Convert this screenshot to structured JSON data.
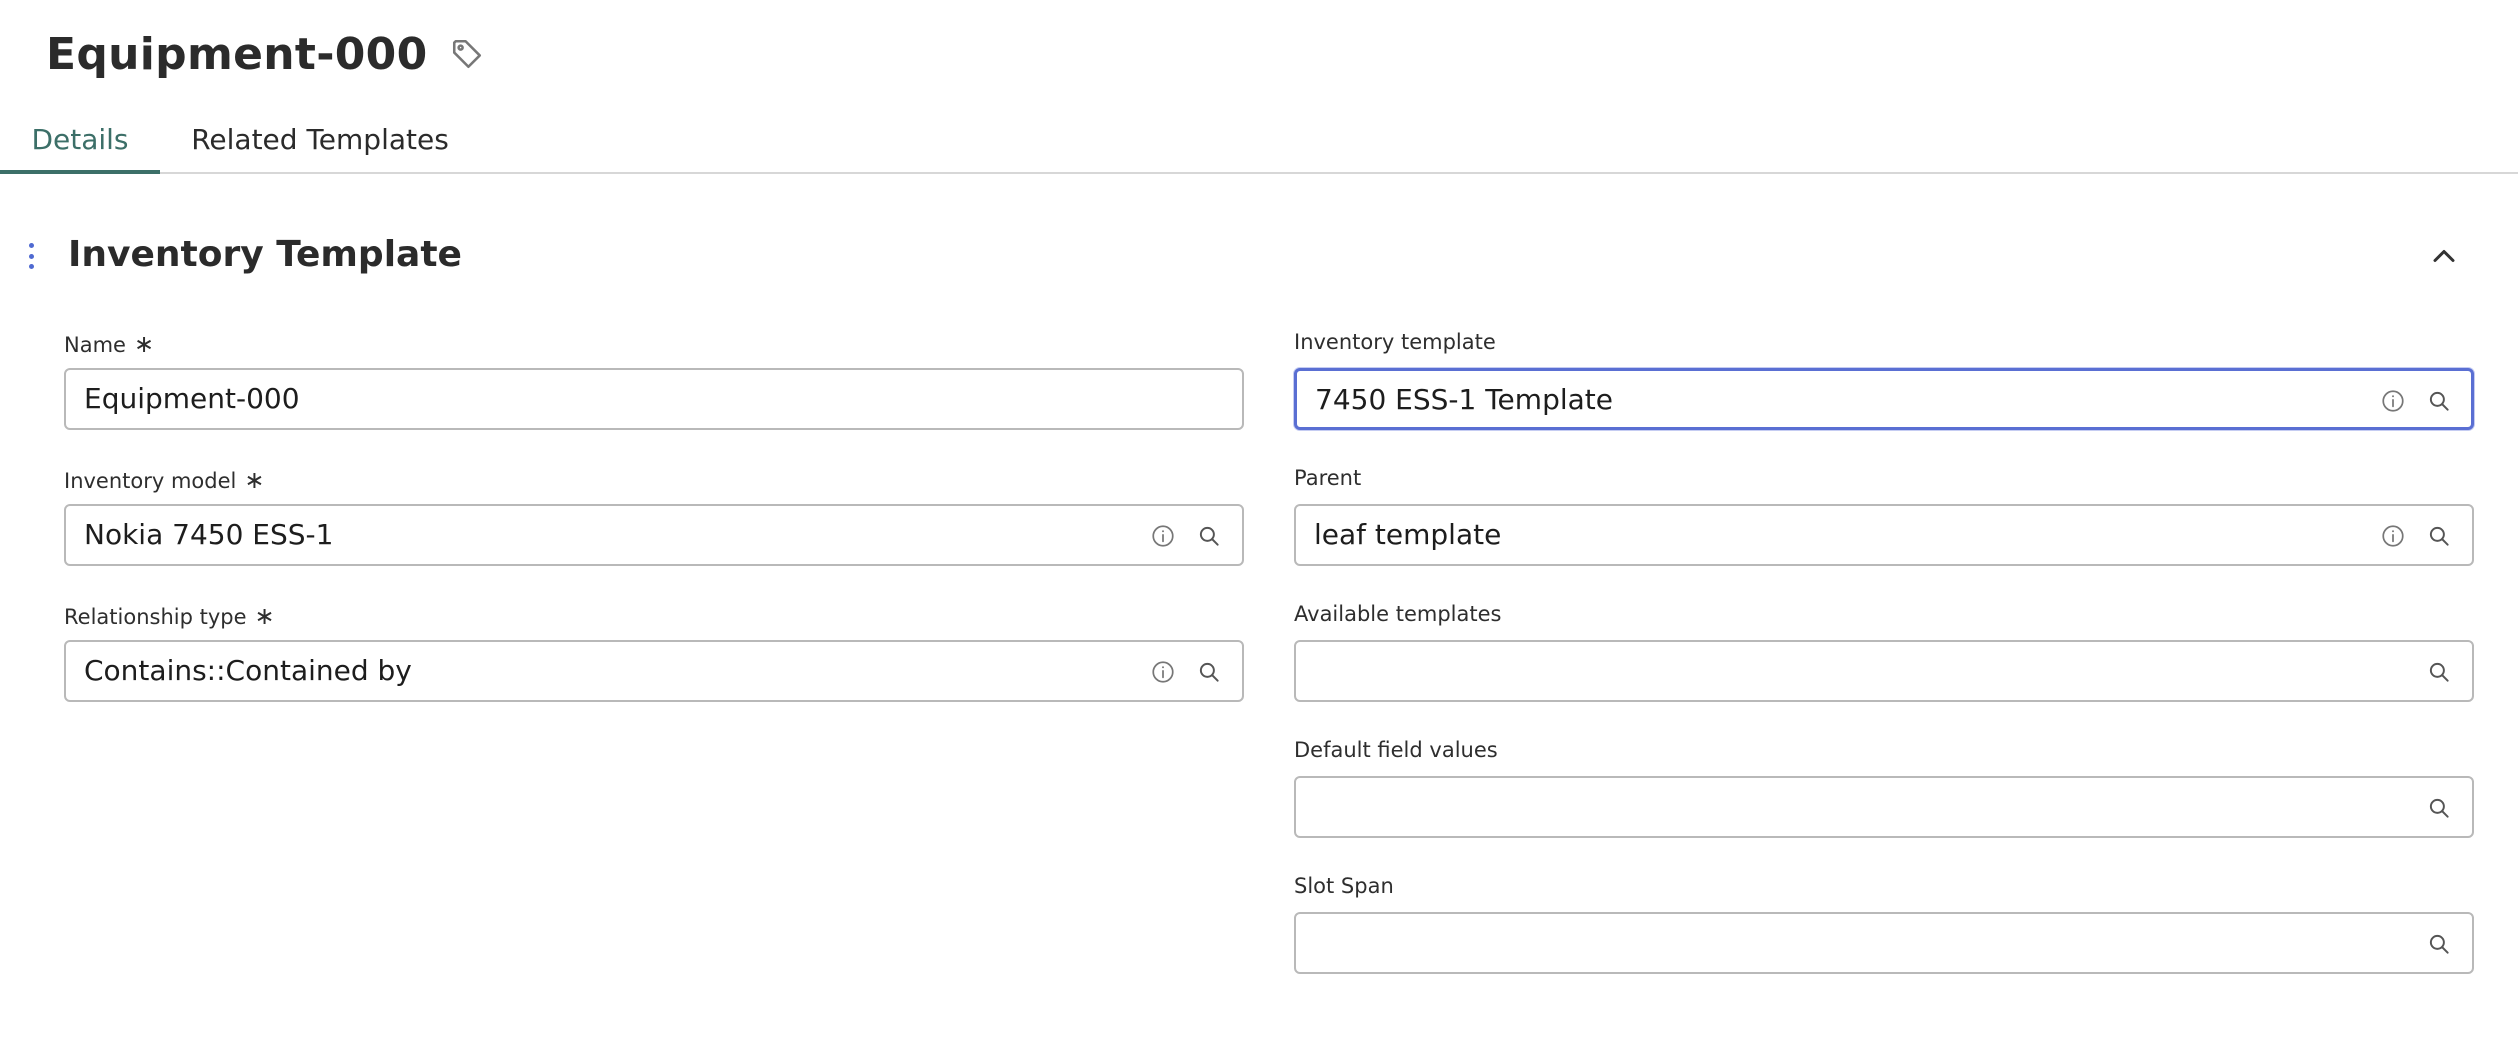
{
  "header": {
    "title": "Equipment-000",
    "tag_icon": "tag-icon"
  },
  "tabs": [
    {
      "label": "Details",
      "active": true
    },
    {
      "label": "Related Templates",
      "active": false
    }
  ],
  "section": {
    "title": "Inventory Template",
    "collapse_icon": "chevron-up-icon"
  },
  "required_marker": "∗",
  "fields": {
    "name": {
      "label": "Name",
      "required": true,
      "value": "Equipment-000"
    },
    "inventory_model": {
      "label": "Inventory model",
      "required": true,
      "value": "Nokia 7450 ESS-1"
    },
    "relationship_type": {
      "label": "Relationship type",
      "required": true,
      "value": "Contains::Contained by"
    },
    "inventory_template": {
      "label": "Inventory template",
      "required": false,
      "value": "7450 ESS-1 Template"
    },
    "parent": {
      "label": "Parent",
      "required": false,
      "value": "leaf template"
    },
    "available_templates": {
      "label": "Available templates",
      "required": false,
      "value": ""
    },
    "default_field_values": {
      "label": "Default field values",
      "required": false,
      "value": ""
    },
    "slot_span": {
      "label": "Slot Span",
      "required": false,
      "value": ""
    }
  },
  "colors": {
    "accent": "#3c6f68",
    "focus": "#5a6fd3",
    "border": "#b9b9b9"
  }
}
